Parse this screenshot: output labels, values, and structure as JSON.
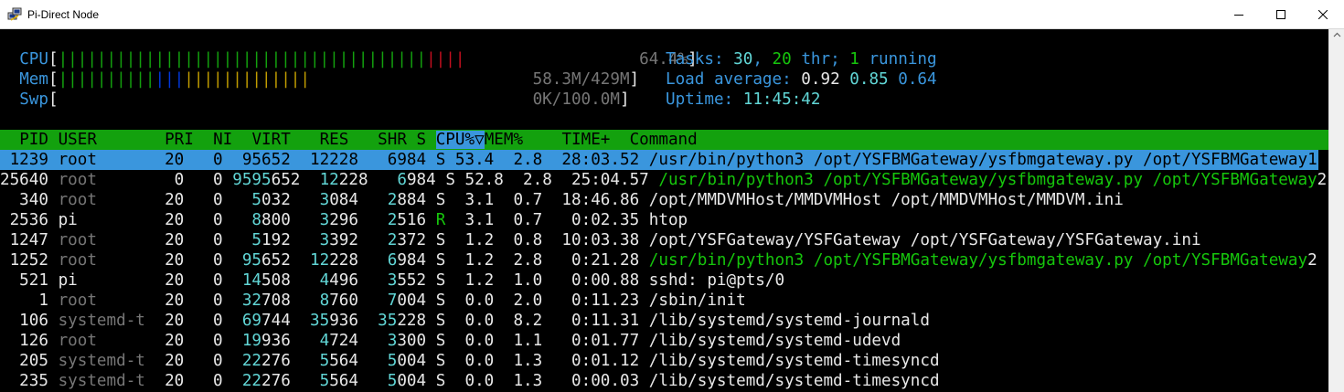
{
  "window": {
    "title": "Pi-Direct Node",
    "accent": "#3a96dd",
    "header_bg": "#13a10e"
  },
  "meters": {
    "cpu": {
      "label": "CPU",
      "value": "64.4%",
      "green_bars": "||||||||||||||||||||||||||||||||||||||",
      "red_bars": "||||",
      "fill_fraction": 0.644
    },
    "mem": {
      "label": "Mem",
      "value": "58.3M/429M",
      "green_bars": "||||||||||",
      "blue_bars": "|||",
      "yellow_bars": "|||||||||||||",
      "fill_fraction": 0.136
    },
    "swp": {
      "label": "Swp",
      "value": "0K/100.0M",
      "fill_fraction": 0.0
    }
  },
  "summary": {
    "tasks_label": "Tasks:",
    "tasks": "30",
    "thr": "20",
    "thr_label": "thr;",
    "running": "1",
    "running_label": "running",
    "load_label": "Load average:",
    "load1": "0.92",
    "load5": "0.85",
    "load15": "0.64",
    "uptime_label": "Uptime:",
    "uptime": "11:45:42"
  },
  "columns": [
    "PID",
    "USER",
    "PRI",
    "NI",
    "VIRT",
    "RES",
    "SHR",
    "S",
    "CPU%▽",
    "MEM%",
    "TIME+",
    "Command"
  ],
  "processes": [
    {
      "pid": "1239",
      "user": "root",
      "pri": "20",
      "ni": "0",
      "virt": "95652",
      "res": "12228",
      "shr": "6984",
      "s": "S",
      "cpu": "53.4",
      "mem": "2.8",
      "time": "28:03.52",
      "cmd": "/usr/bin/python3 /opt/YSFBMGateway/ysfbmgateway.py /opt/YSFBMGateway",
      "wrap": "1",
      "selected": true
    },
    {
      "pid": "25640",
      "user": "root",
      "pri": "0",
      "ni": "0",
      "virt": "9595652",
      "res": "12228",
      "shr": "6984",
      "s": "S",
      "cpu": "52.8",
      "mem": "2.8",
      "time": "25:04.57",
      "cmd": "/usr/bin/python3 /opt/YSFBMGateway/ysfbmgateway.py /opt/YSFBMGateway",
      "wrap": "2"
    },
    {
      "pid": "340",
      "user": "root",
      "pri": "20",
      "ni": "0",
      "virt": "5032",
      "res": "3084",
      "shr": "2884",
      "s": "S",
      "cpu": "3.1",
      "mem": "0.7",
      "time": "18:46.86",
      "cmd": "/opt/MMDVMHost/MMDVMHost /opt/MMDVMHost/MMDVM.ini"
    },
    {
      "pid": "2536",
      "user": "pi",
      "pri": "20",
      "ni": "0",
      "virt": "8800",
      "res": "3296",
      "shr": "2516",
      "s": "R",
      "cpu": "3.1",
      "mem": "0.7",
      "time": "0:02.35",
      "cmd": "htop"
    },
    {
      "pid": "1247",
      "user": "root",
      "pri": "20",
      "ni": "0",
      "virt": "5192",
      "res": "3392",
      "shr": "2372",
      "s": "S",
      "cpu": "1.2",
      "mem": "0.8",
      "time": "10:03.38",
      "cmd": "/opt/YSFGateway/YSFGateway /opt/YSFGateway/YSFGateway.ini"
    },
    {
      "pid": "1252",
      "user": "root",
      "pri": "20",
      "ni": "0",
      "virt": "95652",
      "res": "12228",
      "shr": "6984",
      "s": "S",
      "cpu": "1.2",
      "mem": "2.8",
      "time": "0:21.28",
      "cmd": "/usr/bin/python3 /opt/YSFBMGateway/ysfbmgateway.py /opt/YSFBMGateway",
      "wrap": "2"
    },
    {
      "pid": "521",
      "user": "pi",
      "pri": "20",
      "ni": "0",
      "virt": "14508",
      "res": "4496",
      "shr": "3552",
      "s": "S",
      "cpu": "1.2",
      "mem": "1.0",
      "time": "0:00.88",
      "cmd": "sshd: pi@pts/0"
    },
    {
      "pid": "1",
      "user": "root",
      "pri": "20",
      "ni": "0",
      "virt": "32708",
      "res": "8760",
      "shr": "7004",
      "s": "S",
      "cpu": "0.0",
      "mem": "2.0",
      "time": "0:11.23",
      "cmd": "/sbin/init"
    },
    {
      "pid": "106",
      "user": "systemd-t",
      "pri": "20",
      "ni": "0",
      "virt": "69744",
      "res": "35936",
      "shr": "35228",
      "s": "S",
      "cpu": "0.0",
      "mem": "8.2",
      "time": "0:11.31",
      "cmd": "/lib/systemd/systemd-journald"
    },
    {
      "pid": "126",
      "user": "root",
      "pri": "20",
      "ni": "0",
      "virt": "19936",
      "res": "4724",
      "shr": "3300",
      "s": "S",
      "cpu": "0.0",
      "mem": "1.1",
      "time": "0:01.77",
      "cmd": "/lib/systemd/systemd-udevd"
    },
    {
      "pid": "205",
      "user": "systemd-t",
      "pri": "20",
      "ni": "0",
      "virt": "22276",
      "res": "5564",
      "shr": "5004",
      "s": "S",
      "cpu": "0.0",
      "mem": "1.3",
      "time": "0:01.12",
      "cmd": "/lib/systemd/systemd-timesyncd"
    },
    {
      "pid": "235",
      "user": "systemd-t",
      "pri": "20",
      "ni": "0",
      "virt": "22276",
      "res": "5564",
      "shr": "5004",
      "s": "S",
      "cpu": "0.0",
      "mem": "1.3",
      "time": "0:00.03",
      "cmd": "/lib/systemd/systemd-timesyncd"
    }
  ]
}
